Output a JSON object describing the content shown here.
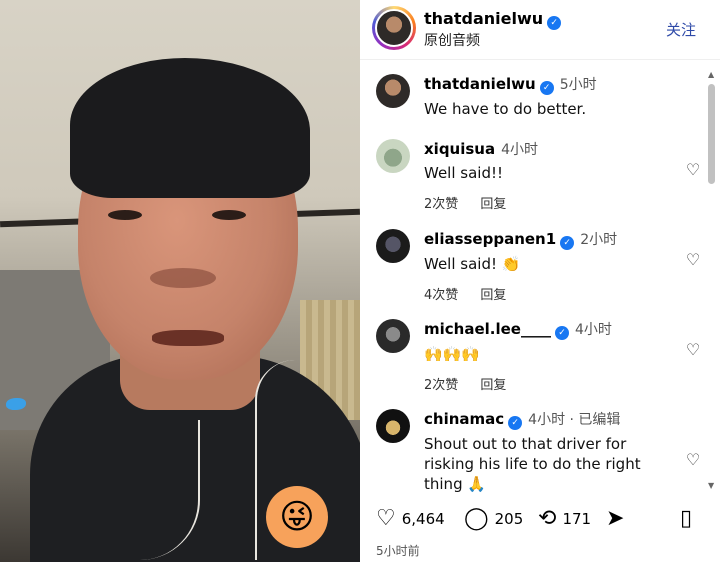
{
  "header": {
    "username": "thatdanielwu",
    "subtitle": "原创音频",
    "follow_label": "关注"
  },
  "caption": {
    "username": "thatdanielwu",
    "time": "5小时",
    "text": "We have to do better."
  },
  "comments": [
    {
      "username": "xiquisua",
      "verified": false,
      "time": "4小时",
      "text": "Well said!!",
      "likes": "2次赞",
      "reply": "回复"
    },
    {
      "username": "eliasseppanen1",
      "verified": true,
      "time": "2小时",
      "text": "Well said! 👏",
      "likes": "4次赞",
      "reply": "回复"
    },
    {
      "username": "michael.lee____",
      "verified": true,
      "time": "4小时",
      "text": "🙌🙌🙌",
      "likes": "2次赞",
      "reply": "回复"
    },
    {
      "username": "chinamac",
      "verified": true,
      "time": "4小时 · 已编辑",
      "text": "Shout out to that driver for risking his life to do the right thing 🙏",
      "likes": "",
      "reply": ""
    }
  ],
  "actions": {
    "like_count": "6,464",
    "comment_count": "205",
    "share_count": "171"
  },
  "post_time": "5小时前",
  "icons": {
    "like": "heart-icon",
    "comment": "comment-icon",
    "repost": "repost-icon",
    "share": "share-icon",
    "save": "bookmark-icon"
  },
  "colors": {
    "verified": "#1877f2",
    "follow": "#2e4aa8"
  }
}
